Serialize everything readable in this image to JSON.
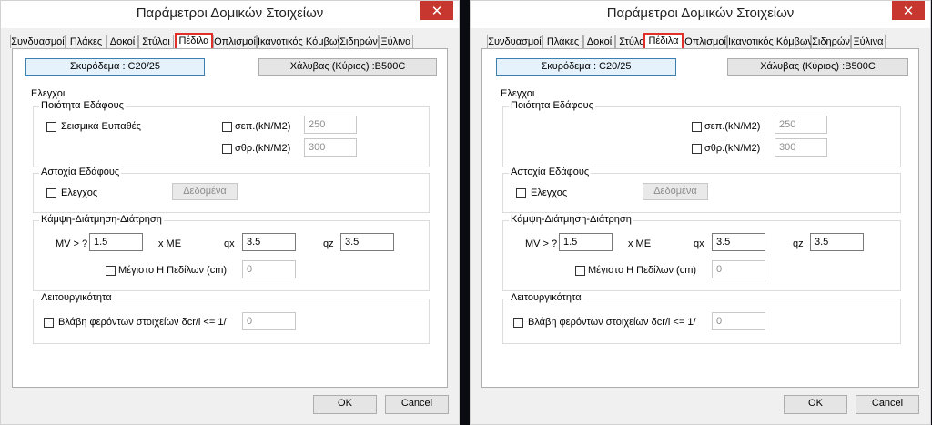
{
  "dialog": {
    "title": "Παράμετροι Δομικών Στοιχείων",
    "close": "✕",
    "tabs": [
      "Συνδυασμοί",
      "Πλάκες",
      "Δοκοί",
      "Στύλοι",
      "Πέδιλα",
      "Οπλισμοί",
      "Ικανοτικός Κόμβων",
      "Σιδηρών",
      "Ξύλινα"
    ],
    "active_tab": "Πέδιλα",
    "concrete_button": "Σκυρόδεμα : C20/25",
    "steel_button": "Χάλυβας  (Κύριος) :B500C",
    "checks_title": "Ελεγχοι",
    "soil_quality": {
      "title": "Ποιότητα Εδάφους",
      "seismic": "Σεισμικά Ευπαθές",
      "sep": "σεπ.(kN/M2)",
      "sep_value": "250",
      "sthr": "σθρ.(kN/M2)",
      "sthr_value": "300"
    },
    "soil_failure": {
      "title": "Αστοχία Εδάφους",
      "check": "Ελεγχος",
      "data_button": "Δεδομένα"
    },
    "bending": {
      "title": "Κάμψη-Διάτμηση-Διάτρηση",
      "mv": "MV > ?",
      "mv_value": "1.5",
      "xme": "x ME",
      "qx": "qx",
      "qx_value": "3.5",
      "qz": "qz",
      "qz_value": "3.5",
      "max_h": "Μέγιστο Η Πεδίλων (cm)",
      "max_h_value": "0"
    },
    "serviceability": {
      "title": "Λειτουργικότητα",
      "damage": "Βλάβη φερόντων στοιχείων δcr/l <= 1/",
      "damage_value": "0"
    },
    "ok": "OK",
    "cancel": "Cancel"
  }
}
